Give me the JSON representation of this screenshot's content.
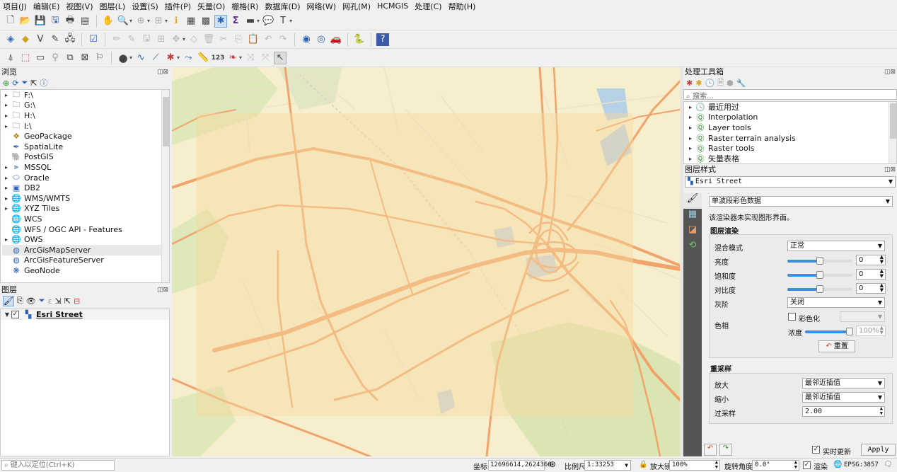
{
  "menu": [
    "项目(J)",
    "编辑(E)",
    "视图(V)",
    "图层(L)",
    "设置(S)",
    "插件(P)",
    "矢量(O)",
    "栅格(R)",
    "数据库(D)",
    "网络(W)",
    "网孔(M)",
    "HCMGIS",
    "处理(C)",
    "帮助(H)"
  ],
  "browser": {
    "title": "浏览",
    "items": [
      {
        "label": "F:\\",
        "icon": "folder-icon"
      },
      {
        "label": "G:\\",
        "icon": "folder-icon"
      },
      {
        "label": "H:\\",
        "icon": "folder-icon"
      },
      {
        "label": "I:\\",
        "icon": "folder-icon"
      },
      {
        "label": "GeoPackage",
        "icon": "geopackage-icon"
      },
      {
        "label": "SpatiaLite",
        "icon": "spatialite-icon"
      },
      {
        "label": "PostGIS",
        "icon": "postgis-icon"
      },
      {
        "label": "MSSQL",
        "icon": "mssql-icon"
      },
      {
        "label": "Oracle",
        "icon": "oracle-icon"
      },
      {
        "label": "DB2",
        "icon": "db2-icon"
      },
      {
        "label": "WMS/WMTS",
        "icon": "globe-icon"
      },
      {
        "label": "XYZ Tiles",
        "icon": "globe-icon"
      },
      {
        "label": "WCS",
        "icon": "globe-icon"
      },
      {
        "label": "WFS / OGC API - Features",
        "icon": "globe-icon"
      },
      {
        "label": "OWS",
        "icon": "globe-icon"
      },
      {
        "label": "ArcGisMapServer",
        "icon": "arcgis-icon"
      },
      {
        "label": "ArcGisFeatureServer",
        "icon": "arcgis-icon"
      },
      {
        "label": "GeoNode",
        "icon": "geonode-icon"
      }
    ]
  },
  "layers": {
    "title": "图层",
    "items": [
      {
        "label": "Esri Street",
        "checked": true
      }
    ]
  },
  "processing": {
    "title": "处理工具箱",
    "search_placeholder": "搜索...",
    "items": [
      "最近用过",
      "Interpolation",
      "Layer tools",
      "Raster terrain analysis",
      "Raster tools",
      "矢量表格"
    ]
  },
  "style": {
    "title": "图层样式",
    "layer": "Esri Street",
    "renderer": "单波段彩色数据",
    "note": "该渲染器未实现图形界面。",
    "render_section": "图层渲染",
    "blend_label": "混合模式",
    "blend_value": "正常",
    "brightness_label": "亮度",
    "brightness_value": "0",
    "saturation_label": "饱和度",
    "saturation_value": "0",
    "contrast_label": "对比度",
    "contrast_value": "0",
    "gray_label": "灰阶",
    "gray_value": "关闭",
    "hue_label": "色相",
    "colorize_label": "彩色化",
    "strength_label": "浓度",
    "strength_value": "100%",
    "reset_label": "重置",
    "resample_section": "重采样",
    "zoomin_label": "放大",
    "zoomin_value": "最邻近插值",
    "zoomout_label": "缩小",
    "zoomout_value": "最邻近插值",
    "oversample_label": "过采样",
    "oversample_value": "2.00",
    "live_update": "实时更新",
    "apply": "Apply"
  },
  "status": {
    "locate_placeholder": "键入以定位(Ctrl+K)",
    "coord_label": "坐标",
    "coord_value": "12696614,2624366",
    "scale_label": "比例尺",
    "scale_value": "1:33253",
    "magnifier_label": "放大镜",
    "magnifier_value": "100%",
    "rotation_label": "旋转角度",
    "rotation_value": "0.0°",
    "render_label": "渲染",
    "crs": "EPSG:3857"
  },
  "colors": {
    "road": "#f0a46c",
    "road_edge": "#e08a55",
    "overlay": "#f7d9a0",
    "park": "#dde8b8",
    "water": "#b4cfe8"
  }
}
